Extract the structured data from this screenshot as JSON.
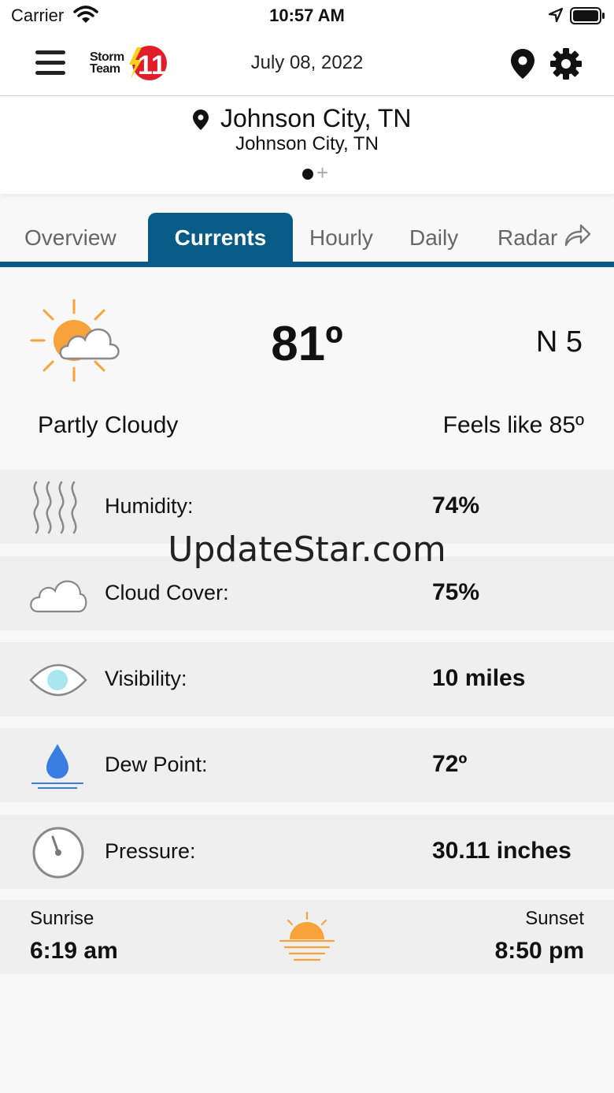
{
  "status_bar": {
    "carrier": "Carrier",
    "time": "10:57 AM"
  },
  "header": {
    "logo_text_1": "Storm",
    "logo_text_2": "Team",
    "logo_number": "11",
    "date": "July 08, 2022"
  },
  "location": {
    "primary": "Johnson City, TN",
    "secondary": "Johnson City, TN"
  },
  "tabs": [
    {
      "label": "Overview",
      "active": false
    },
    {
      "label": "Currents",
      "active": true
    },
    {
      "label": "Hourly",
      "active": false
    },
    {
      "label": "Daily",
      "active": false
    },
    {
      "label": "Radar",
      "active": false
    }
  ],
  "current": {
    "temperature": "81º",
    "wind": "N 5",
    "condition": "Partly Cloudy",
    "feels_like": "Feels like 85º",
    "icon": "partly-cloudy-icon"
  },
  "details": [
    {
      "icon": "humidity-icon",
      "label": "Humidity:",
      "value": "74%"
    },
    {
      "icon": "cloud-icon",
      "label": "Cloud Cover:",
      "value": "75%"
    },
    {
      "icon": "eye-icon",
      "label": "Visibility:",
      "value": "10 miles"
    },
    {
      "icon": "droplet-icon",
      "label": "Dew Point:",
      "value": "72º"
    },
    {
      "icon": "gauge-icon",
      "label": "Pressure:",
      "value": "30.11 inches"
    }
  ],
  "sun": {
    "sunrise_label": "Sunrise",
    "sunrise": "6:19 am",
    "sunset_label": "Sunset",
    "sunset": "8:50 pm"
  },
  "watermark": "UpdateStar.com",
  "colors": {
    "accent": "#075b86",
    "sun": "#f7a23a",
    "water": "#3a7de0"
  }
}
